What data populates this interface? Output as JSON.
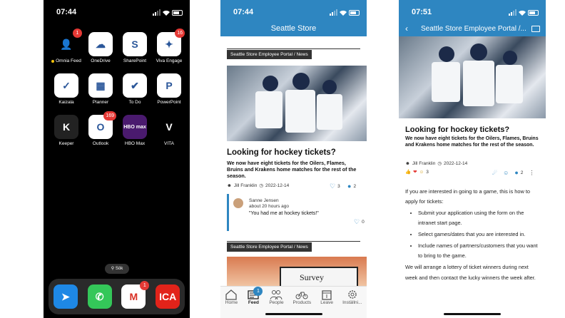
{
  "phone1": {
    "time": "07:44",
    "apps": [
      {
        "label": "Omnia Feed",
        "badge": "1",
        "color": "#000000",
        "glyph": "👤",
        "dot": true
      },
      {
        "label": "OneDrive",
        "badge": "",
        "color": "#ffffff",
        "glyph": "☁"
      },
      {
        "label": "SharePoint",
        "badge": "",
        "color": "#ffffff",
        "glyph": "S"
      },
      {
        "label": "Viva Engage",
        "badge": "16",
        "color": "#ffffff",
        "glyph": "✦"
      },
      {
        "label": "Kaizala",
        "badge": "",
        "color": "#ffffff",
        "glyph": "✓"
      },
      {
        "label": "Planner",
        "badge": "",
        "color": "#ffffff",
        "glyph": "▦"
      },
      {
        "label": "To Do",
        "badge": "",
        "color": "#ffffff",
        "glyph": "✔"
      },
      {
        "label": "PowerPoint",
        "badge": "",
        "color": "#ffffff",
        "glyph": "P"
      },
      {
        "label": "Keeper",
        "badge": "",
        "color": "#222222",
        "glyph": "K"
      },
      {
        "label": "Outlook",
        "badge": "169",
        "color": "#ffffff",
        "glyph": "O"
      },
      {
        "label": "HBO Max",
        "badge": "",
        "color": "#4a1a6e",
        "glyph": "HBO max"
      },
      {
        "label": "VITA",
        "badge": "",
        "color": "#000000",
        "glyph": "V"
      }
    ],
    "search_label": "Sök",
    "dock": [
      {
        "name": "safari",
        "badge": "",
        "color": "#1e88e5",
        "glyph": "➤"
      },
      {
        "name": "phone",
        "badge": "",
        "color": "#34c759",
        "glyph": "✆"
      },
      {
        "name": "gmail",
        "badge": "1",
        "color": "#ffffff",
        "glyph": "M"
      },
      {
        "name": "ica",
        "badge": "",
        "color": "#e2231a",
        "glyph": "ICA"
      }
    ]
  },
  "phone2": {
    "time": "07:44",
    "header_title": "Seattle Store",
    "tag": "Seattle Store Employee Portal / News",
    "headline": "Looking for hockey tickets?",
    "lead": "We now have eight tickets for the Oilers, Flames, Bruins and Krakens home matches for the rest of the season.",
    "author": "Jill Franklin",
    "date": "2022-12-14",
    "likes": "3",
    "comments": "2",
    "comment": {
      "author": "Sanne Jensen",
      "time": "about 20 hours ago",
      "text": "\"You had me at hockey tickets!\"",
      "likes": "0"
    },
    "tag2": "Seattle Store Employee Portal / News",
    "survey_label": "Survey",
    "nav": [
      {
        "label": "Home",
        "icon": "home-icon",
        "badge": ""
      },
      {
        "label": "Feed",
        "icon": "feed-icon",
        "badge": "1",
        "active": true
      },
      {
        "label": "People",
        "icon": "people-icon",
        "badge": ""
      },
      {
        "label": "Products",
        "icon": "bike-icon",
        "badge": ""
      },
      {
        "label": "Leave",
        "icon": "calendar-icon",
        "badge": ""
      },
      {
        "label": "Inställni...",
        "icon": "gear-icon",
        "badge": ""
      }
    ],
    "colors": {
      "header": "#2e86c1"
    }
  },
  "phone3": {
    "time": "07:51",
    "header_title": "Seattle Store Employee Portal /...",
    "headline": "Looking for hockey tickets?",
    "lead": "We now have eight tickets for the Oilers, Flames, Bruins and Krakens home matches for the rest of the season.",
    "author": "Jill Franklin",
    "date": "2022-12-14",
    "reactions_count": "3",
    "comments": "2",
    "intro": "If you are interested in going to a game, this is how to apply for tickets:",
    "bullets": [
      "Submit your application using the form on the intranet start page.",
      "Select games/dates that you are interested in.",
      "Include names of partners/customers that you want to bring to the game."
    ],
    "outro": "We will arrange a lottery of ticket winners during next week and then contact the lucky winners the week after."
  }
}
